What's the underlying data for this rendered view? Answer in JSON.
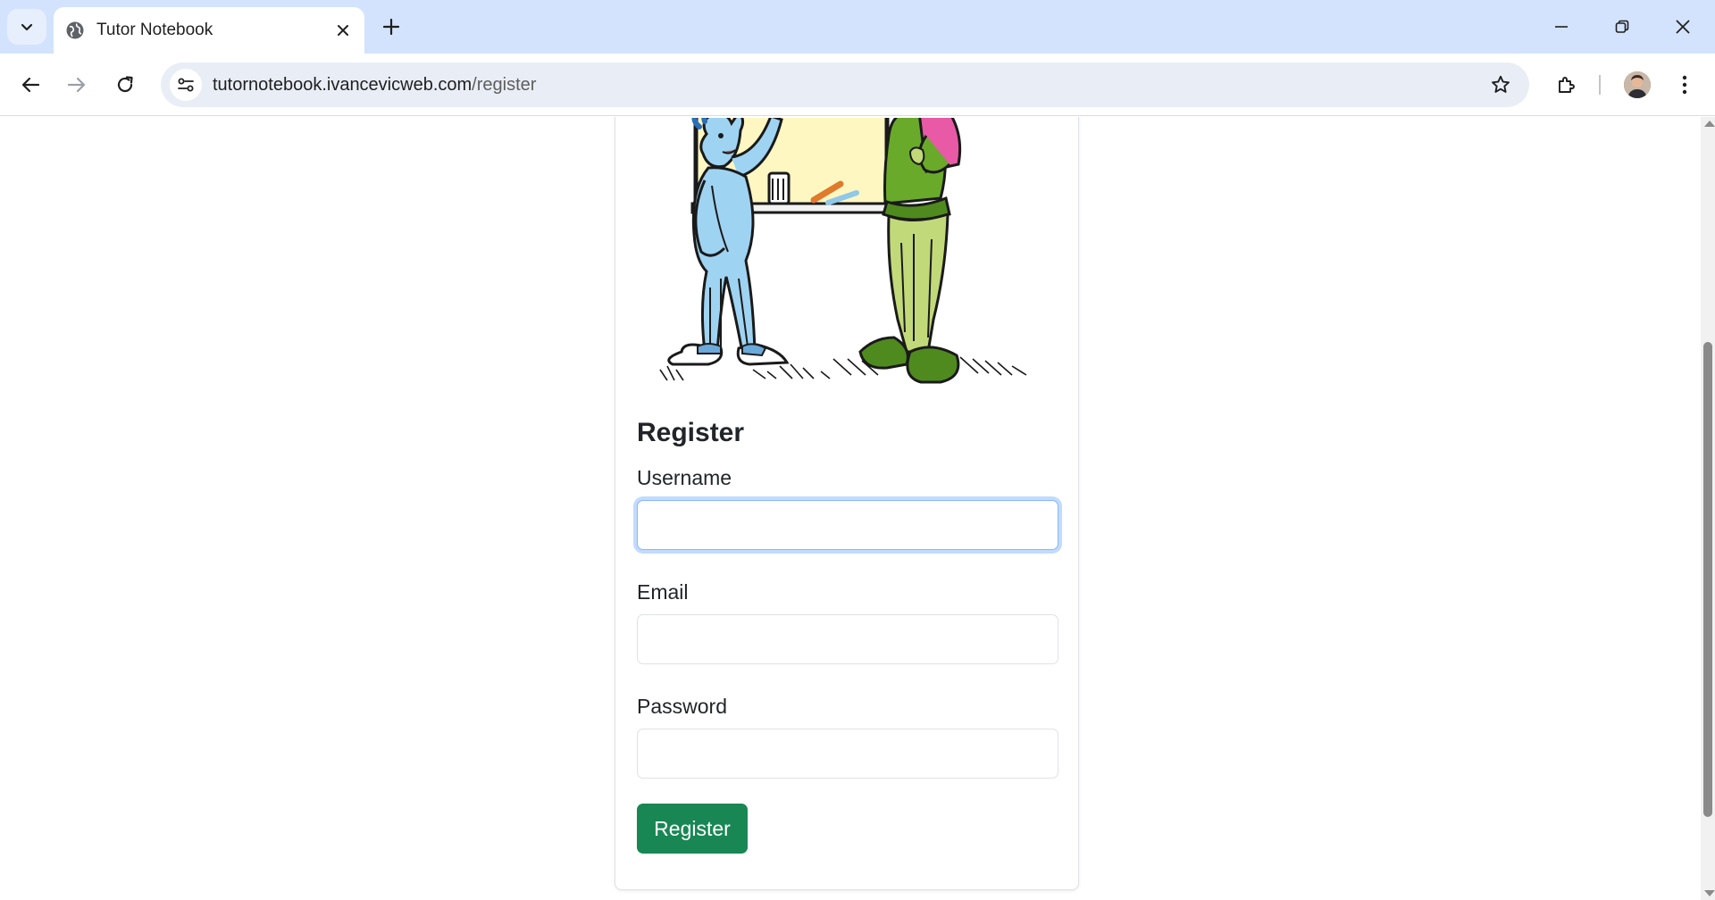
{
  "browser": {
    "tab_title": "Tutor Notebook",
    "url_host": "tutornotebook.ivancevicweb.com",
    "url_path": "/register"
  },
  "colors": {
    "tabbar": "#d3e3fd",
    "omnibox": "#e9eef6",
    "primary_button": "#198754",
    "focus_ring": "#86b7fe"
  },
  "icons": [
    "tab-list-icon",
    "globe-icon",
    "close-icon",
    "plus-icon",
    "minimize-icon",
    "restore-icon",
    "window-close-icon",
    "back-arrow-icon",
    "forward-arrow-icon",
    "reload-icon",
    "site-settings-icon",
    "star-icon",
    "extensions-icon",
    "profile-avatar",
    "more-vert-icon"
  ],
  "form": {
    "title": "Register",
    "username_label": "Username",
    "username_value": "",
    "email_label": "Email",
    "email_value": "",
    "password_label": "Password",
    "password_value": "",
    "submit_label": "Register"
  }
}
